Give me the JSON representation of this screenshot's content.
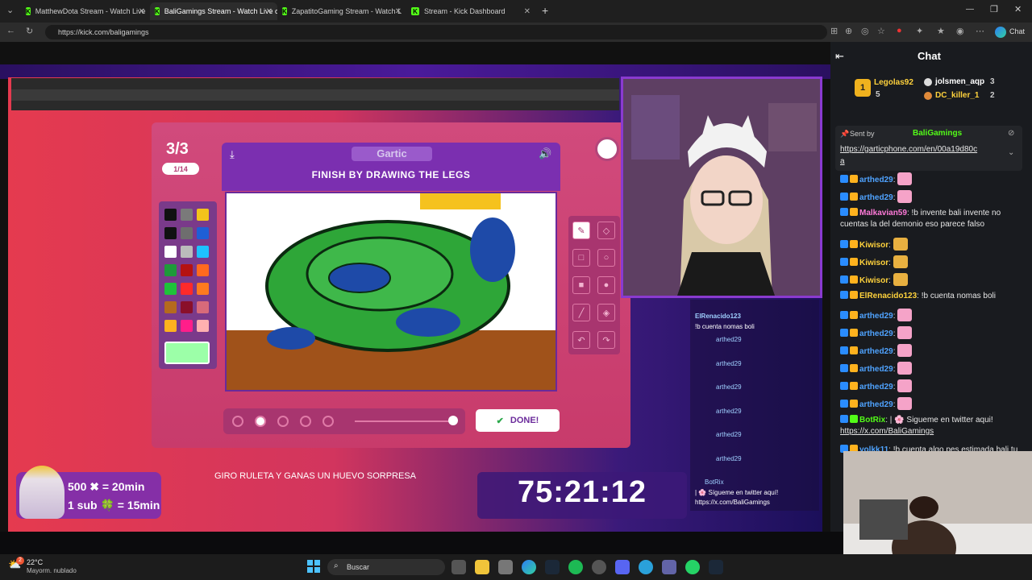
{
  "browser": {
    "tabs": [
      {
        "label": "MatthewDota Stream - Watch Live"
      },
      {
        "label": "BaliGamings Stream - Watch Live o"
      },
      {
        "label": "ZapatitoGaming Stream - Watch L"
      },
      {
        "label": "Stream - Kick Dashboard"
      }
    ],
    "url": "https://kick.com/baligamings",
    "chat_button": "Chat"
  },
  "game": {
    "round": "3/3",
    "count_badge": "1/14",
    "logo": "Gartic",
    "instruction": "FINISH BY DRAWING THE LEGS",
    "done_label": "DONE!",
    "palette_colors": [
      "#111111",
      "#7a7a7a",
      "#f3c41b",
      "#111111",
      "#6e6e6e",
      "#1e5fd6",
      "#ffffff",
      "#bbbbbb",
      "#1ec2ff",
      "#1e9a3a",
      "#b51212",
      "#ff6a1e",
      "#1ec23a",
      "#ff2a2a",
      "#ff7a1e",
      "#b56a1e",
      "#8a0f2a",
      "#d86a7a",
      "#ffb21e",
      "#ff1e8a",
      "#ffb0b0"
    ],
    "selected_color": "#9cffa8"
  },
  "overlay": {
    "sub_line1": "500 ✖ = 20min",
    "sub_line2": "1 sub 🍀 = 15min",
    "ruleta": "GIRO RULETA Y GANAS UN HUEVO SORPRESA",
    "timer": "75:21:12",
    "mini_chat": [
      "ElRenacido123",
      "!b cuenta nomas boli",
      "arthed29",
      "arthed29",
      "arthed29",
      "arthed29",
      "arthed29",
      "arthed29",
      "BotRix",
      "| 🌸 Sígueme en twitter aquí!",
      "https://x.com/BaliGamings"
    ]
  },
  "chat": {
    "title": "Chat",
    "gifters": [
      {
        "name": "Legolas92",
        "count": "5"
      },
      {
        "name": "jolsmen_aqp",
        "count": "3"
      },
      {
        "name": "DC_killer_1",
        "count": "2"
      }
    ],
    "pinned": {
      "sent_by_label": "Sent by",
      "sender": "BaliGamings",
      "link": "https://garticphone.com/en/00a19d80c",
      "link_cont": "a"
    },
    "messages": [
      {
        "user": "arthed29",
        "text": ":"
      },
      {
        "user": "arthed29",
        "text": ":"
      },
      {
        "user": "Malkavian59",
        "text": ": !b invente bali invente no"
      },
      {
        "user": "",
        "text": "cuentas la del demonio eso parece falso"
      },
      {
        "user": "Kiwisor",
        "text": ":"
      },
      {
        "user": "Kiwisor",
        "text": ":"
      },
      {
        "user": "Kiwisor",
        "text": ":"
      },
      {
        "user": "ElRenacido123",
        "text": ": !b cuenta nomas boli"
      },
      {
        "user": "arthed29",
        "text": ":"
      },
      {
        "user": "arthed29",
        "text": ":"
      },
      {
        "user": "arthed29",
        "text": ":"
      },
      {
        "user": "arthed29",
        "text": ":"
      },
      {
        "user": "arthed29",
        "text": ":"
      },
      {
        "user": "arthed29",
        "text": ":"
      },
      {
        "user": "BotRix",
        "text": ": | 🌸 Sigueme en twitter aqui!"
      },
      {
        "user": "",
        "text": "https://x.com/BaliGamings"
      },
      {
        "user": "yolkk11",
        "text": ": !b cuenta algo pes estimada bali tu"
      }
    ]
  },
  "taskbar": {
    "weather_temp": "22°C",
    "weather_desc": "Mayorm. nublado",
    "search_placeholder": "Buscar",
    "notification_count": "2"
  }
}
